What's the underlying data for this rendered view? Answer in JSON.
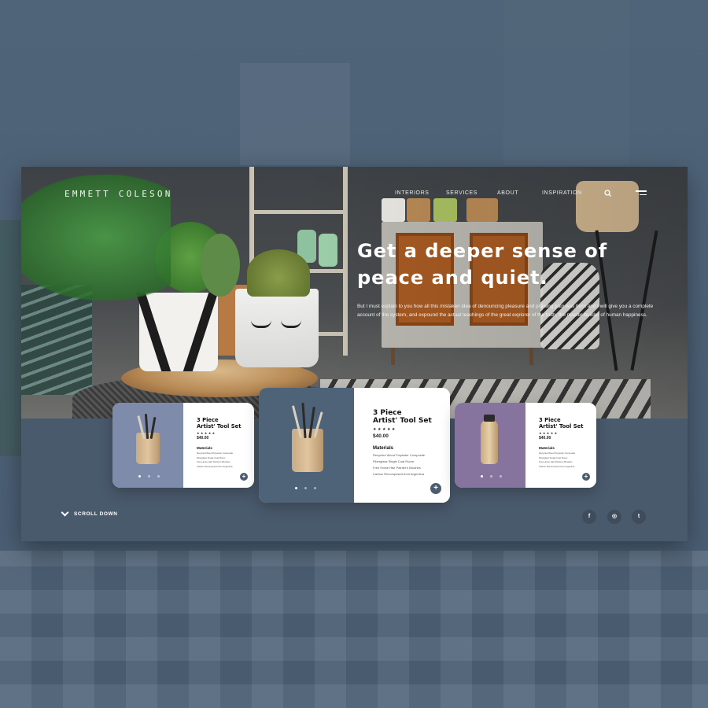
{
  "brand": "EMMETT COLESON",
  "nav": [
    "INTERIORS",
    "SERVICES",
    "ABOUT",
    "INSPIRATION"
  ],
  "hero": {
    "headline_line1": "Get a deeper sense of",
    "headline_line2": "peace and quiet.",
    "body": "But I must explain to you how all this mistaken idea of denouncing pleasure and praising pain was born and I will give you a complete account of the system, and expound the actual teachings of the great explorer of the truth, the master-builder of human happiness."
  },
  "cards": [
    {
      "title_line1": "3 Piece",
      "title_line2": "Artist' Tool Set",
      "stars": "★★★★★",
      "price": "$40.00",
      "materials_heading": "Materials",
      "materials": [
        "Recycled Wood Polyester Composite",
        "Fiberglass Single Coat Room",
        "Free Horse Hair Painter's Brushes",
        "Carbon Recomposed from Argentina"
      ],
      "plus": "+"
    },
    {
      "title_line1": "3 Piece",
      "title_line2": "Artist' Tool Set",
      "stars": "★★★★★",
      "price": "$40.00",
      "materials_heading": "Materials",
      "materials": [
        "Recycled Wood Polyester Composite",
        "Fiberglass Single Coat Room",
        "Free Horse Hair Painter's Brushes",
        "Carbon Recomposed from Argentina"
      ],
      "plus": "+"
    },
    {
      "title_line1": "3 Piece",
      "title_line2": "Artist' Tool Set",
      "stars": "★★★★★",
      "price": "$40.00",
      "materials_heading": "Materials",
      "materials": [
        "Recycled Wood Polyester Composite",
        "Fiberglass Single Coat Room",
        "Free Horse Hair Painter's Brushes",
        "Carbon Recomposed from Argentina"
      ],
      "plus": "+"
    }
  ],
  "footer": {
    "scroll_label": "SCROLL DOWN",
    "social": [
      "f",
      "◎",
      "t"
    ]
  },
  "icons": [
    "search-icon",
    "menu-icon",
    "chevron-down-icon",
    "facebook-icon",
    "instagram-icon",
    "twitter-icon",
    "plus-icon"
  ],
  "colors": {
    "panel": "#4a5a6d",
    "card_image_blue": "#7f8bab",
    "card_image_purple": "#86749f",
    "accent_button": "#4d5c6e"
  }
}
